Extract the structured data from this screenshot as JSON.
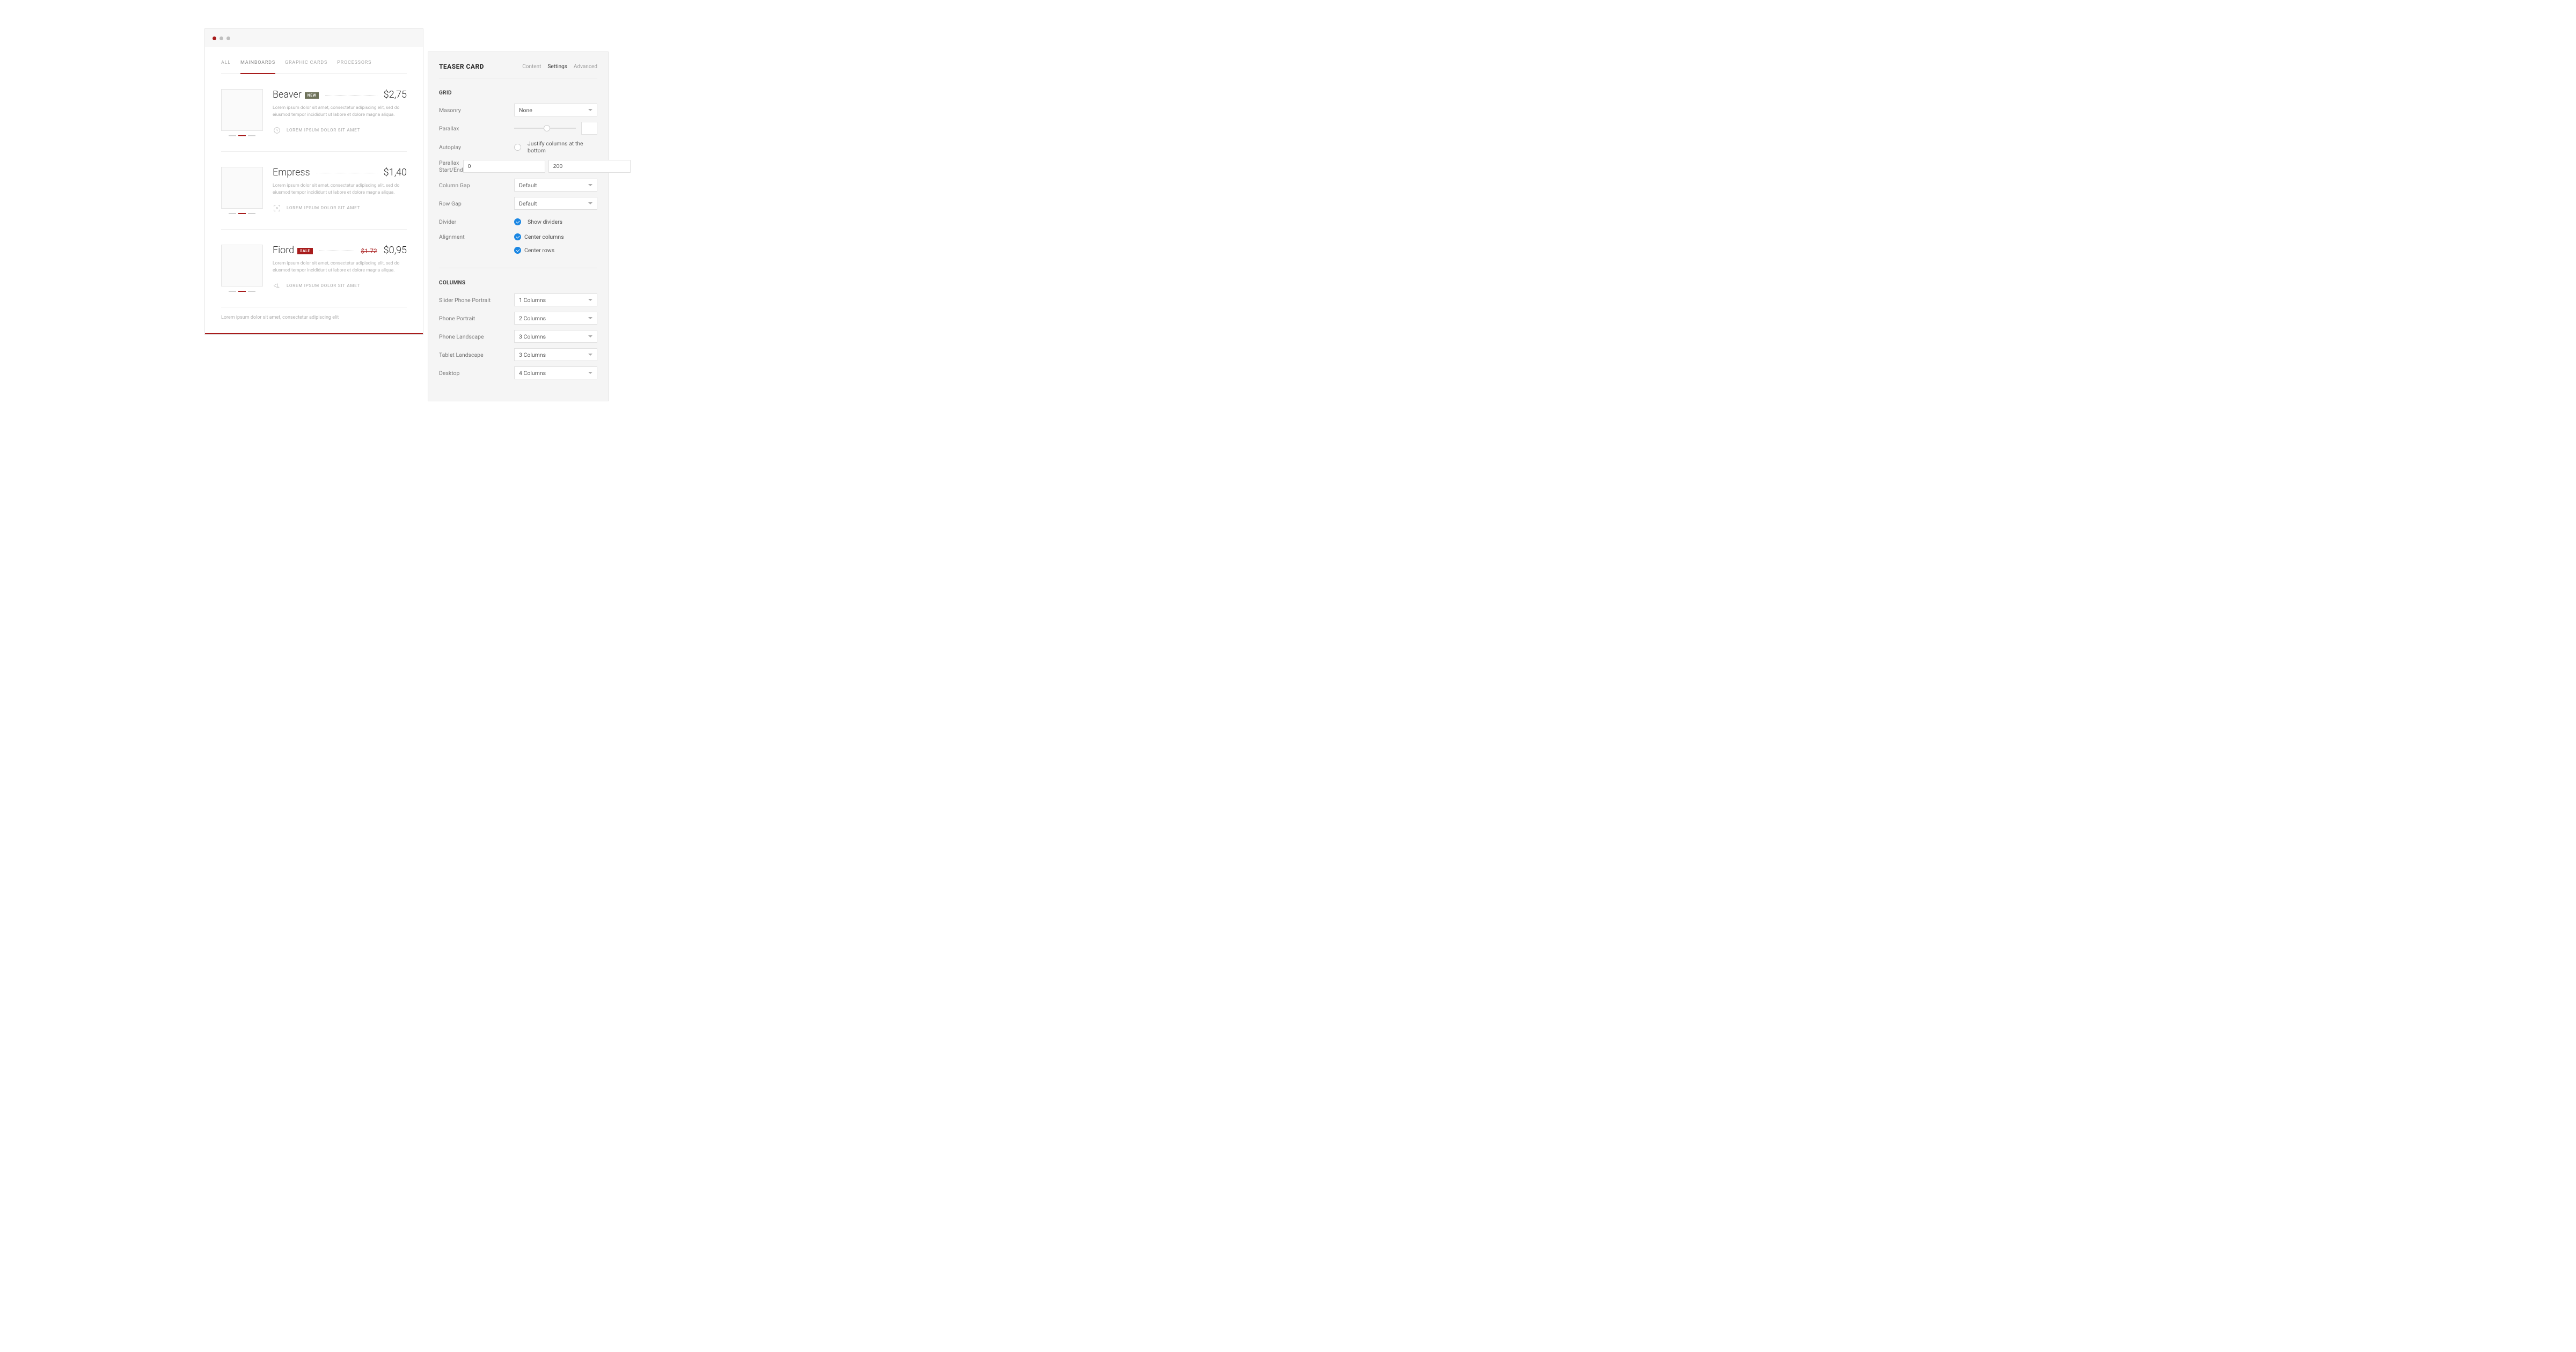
{
  "tabs": [
    "ALL",
    "MAINBOARDS",
    "GRAPHIC CARDS",
    "PROCESSORS"
  ],
  "products": [
    {
      "title": "Beaver",
      "badge": "NEW",
      "price": "$2,75",
      "desc": "Lorem ipsum dolor sit amet, consectetur adipiscing elit, sed do eiusmod tempor incididunt ut labore et dolore magna aliqua.",
      "meta": "LOREM IPSUM DOLOR SIT AMET"
    },
    {
      "title": "Empress",
      "price": "$1,40",
      "desc": "Lorem ipsum dolor sit amet, consectetur adipiscing elit, sed do eiusmod tempor incididunt ut labore et dolore magna aliqua.",
      "meta": "LOREM IPSUM DOLOR SIT AMET"
    },
    {
      "title": "Fiord",
      "badge": "SALE",
      "price_old": "$1.72",
      "price": "$0,95",
      "desc": "Lorem ipsum dolor sit amet, consectetur adipiscing elit, sed do eiusmod tempor incididunt ut labore et dolore magna aliqua.",
      "meta": "LOREM IPSUM DOLOR SIT AMET"
    }
  ],
  "footer": "Lorem ipsum dolor sit amet, consectetur adipiscing elit",
  "panel": {
    "title": "TEASER CARD",
    "tabs": [
      "Content",
      "Settings",
      "Advanced"
    ],
    "grid_section": "GRID",
    "columns_section": "COLUMNS",
    "fields": {
      "masonry": {
        "label": "Masonry",
        "value": "None"
      },
      "parallax_label": "Parallax",
      "autoplay": {
        "label": "Autoplay",
        "check": "Justify columns at the bottom"
      },
      "parallax_range": {
        "label": "Parallax Start/End",
        "start": "0",
        "end": "200"
      },
      "column_gap": {
        "label": "Column Gap",
        "value": "Default"
      },
      "row_gap": {
        "label": "Row Gap",
        "value": "Default"
      },
      "divider": {
        "label": "Divider",
        "check": "Show dividers"
      },
      "alignment": {
        "label": "Alignment",
        "checks": [
          "Center columns",
          "Center rows"
        ]
      }
    },
    "columns": {
      "slider_phone_portrait": {
        "label": "Slider Phone Portrait",
        "value": "1 Columns"
      },
      "phone_portrait": {
        "label": "Phone Portrait",
        "value": "2 Columns"
      },
      "phone_landscape": {
        "label": "Phone Landscape",
        "value": "3 Columns"
      },
      "tablet_landscape": {
        "label": "Tablet Landscape",
        "value": "3 Columns"
      },
      "desktop": {
        "label": "Desktop",
        "value": "4 Columns"
      }
    }
  }
}
